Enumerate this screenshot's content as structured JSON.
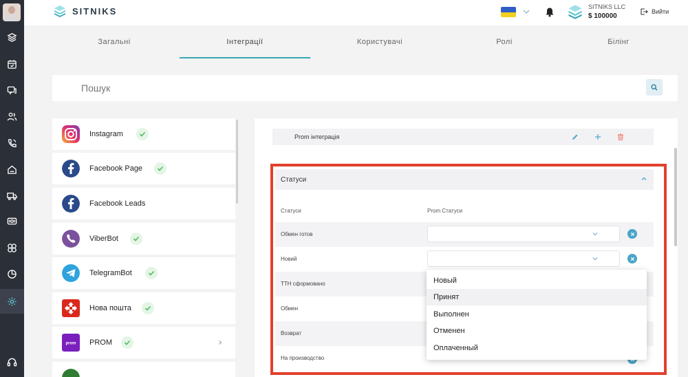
{
  "brand": {
    "name": "SITNIKS"
  },
  "account": {
    "company": "SITNIKS LLC",
    "balance": "$ 100000",
    "logout_label": "Вийти"
  },
  "nav_icons": [
    "layers-icon",
    "calendar-icon",
    "chat-icon",
    "users-icon",
    "phone-icon",
    "home-icon",
    "truck-icon",
    "money-icon",
    "puzzle-icon",
    "chart-pie-icon",
    "settings-icon",
    "headset-icon"
  ],
  "tabs": [
    {
      "label": "Загальні",
      "active": false
    },
    {
      "label": "Інтеграції",
      "active": true
    },
    {
      "label": "Користувачі",
      "active": false
    },
    {
      "label": "Ролі",
      "active": false
    },
    {
      "label": "Білінг",
      "active": false
    }
  ],
  "search": {
    "placeholder": "Пошук"
  },
  "integrations": [
    {
      "name": "Instagram",
      "connected": true
    },
    {
      "name": "Facebook Page",
      "connected": true
    },
    {
      "name": "Facebook Leads",
      "connected": false
    },
    {
      "name": "ViberBot",
      "connected": true
    },
    {
      "name": "TelegramBot",
      "connected": true
    },
    {
      "name": "Нова пошта",
      "connected": true
    },
    {
      "name": "PROM",
      "connected": true,
      "logo_text": "prom"
    }
  ],
  "prom_panel": {
    "title": "Prom інтеграція",
    "section_title": "Статуси",
    "col_statuses": "Статуси",
    "col_prom_statuses": "Prom Статуси",
    "rows": [
      {
        "label": "Обмен готов",
        "value": ""
      },
      {
        "label": "Новий",
        "value": ""
      },
      {
        "label": "ТТН сформовано"
      },
      {
        "label": "Обмен"
      },
      {
        "label": "Возврат"
      },
      {
        "label": "На производство"
      }
    ]
  },
  "dropdown": {
    "options": [
      "Новый",
      "Принят",
      "Выполнен",
      "Отменен",
      "Оплаченный"
    ],
    "hovered": "Принят"
  },
  "colors": {
    "accent": "#37a7b3",
    "highlight_frame": "#e2402c",
    "clear_button": "#4aa4c9",
    "rail": "#2b2f38"
  }
}
